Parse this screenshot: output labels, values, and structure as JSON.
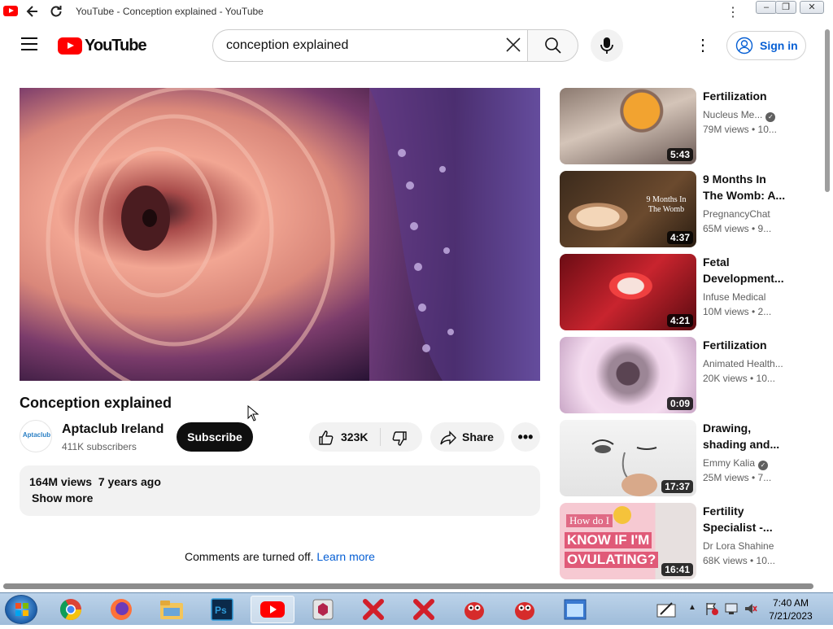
{
  "window": {
    "title": "YouTube - Conception explained - YouTube"
  },
  "masthead": {
    "logo_text": "YouTube",
    "search_value": "conception explained",
    "signin_label": "Sign in"
  },
  "video": {
    "title": "Conception explained",
    "channel": "Aptaclub Ireland",
    "channel_logo_text": "Aptaclub",
    "subscribers": "411K subscribers",
    "subscribe_label": "Subscribe",
    "likes": "323K",
    "share_label": "Share",
    "more_label": "•••",
    "views_date": "164M views  7 years ago",
    "show_more": "Show more",
    "comments_off": "Comments are turned off.",
    "learn_more": "Learn more"
  },
  "recommendations": [
    {
      "title": "Fertilization",
      "channel": "Nucleus Me...",
      "verified": true,
      "meta": "79M views  •  10...",
      "duration": "5:43"
    },
    {
      "title": "9 Months In The Womb: A...",
      "channel": "PregnancyChat",
      "verified": false,
      "meta": "65M views  •  9...",
      "duration": "4:37",
      "thumb_text": "9 Months In The Womb"
    },
    {
      "title": "Fetal Development...",
      "channel": "Infuse Medical",
      "verified": false,
      "meta": "10M views  •  2...",
      "duration": "4:21"
    },
    {
      "title": "Fertilization",
      "channel": "Animated Health...",
      "verified": false,
      "meta": "20K views  •  10...",
      "duration": "0:09"
    },
    {
      "title": "Drawing, shading and...",
      "channel": "Emmy Kalia",
      "verified": true,
      "meta": "25M views  •  7...",
      "duration": "17:37"
    },
    {
      "title": "Fertility Specialist -...",
      "channel": "Dr Lora Shahine",
      "verified": false,
      "meta": "68K views  •  10...",
      "duration": "16:41",
      "thumb_small": "How do I",
      "thumb_big1": "KNOW IF I'M",
      "thumb_big2": "OVULATING?"
    }
  ],
  "taskbar": {
    "time": "7:40 AM",
    "date": "7/21/2023",
    "apps": [
      "start-button",
      "chrome",
      "firefox",
      "file-explorer",
      "photoshop",
      "youtube",
      "app-hex",
      "app-x-red",
      "app-x-red-2",
      "app-bird",
      "app-bird-2",
      "app-window"
    ]
  }
}
